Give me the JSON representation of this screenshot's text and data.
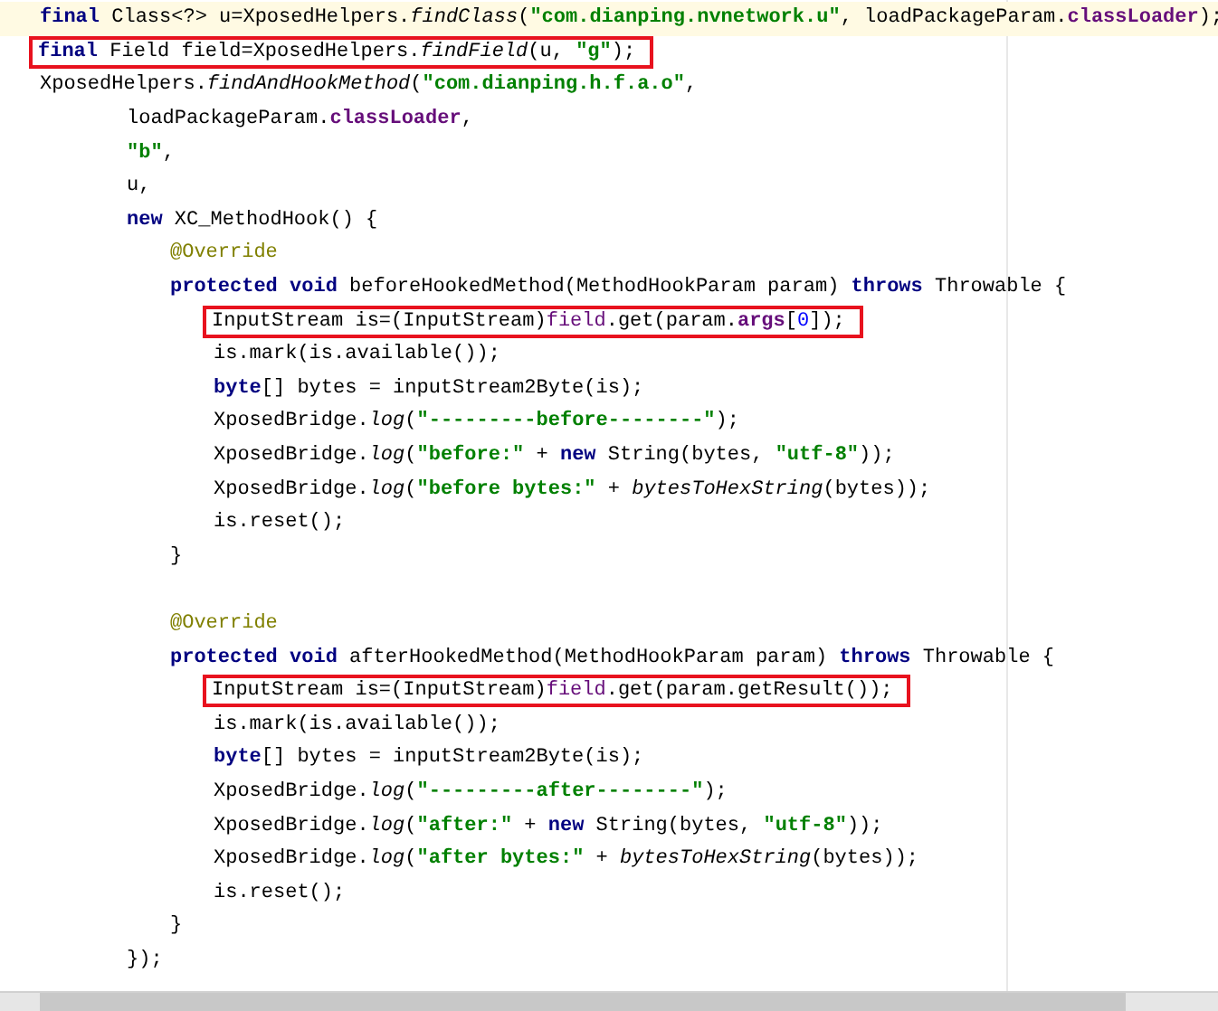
{
  "lines": [
    {
      "current": true,
      "highlighted": false,
      "tokens": [
        {
          "kind": "kw",
          "t": "final"
        },
        {
          "kind": "p",
          "t": " Class<?> u=XposedHelpers."
        },
        {
          "kind": "m",
          "t": "findClass"
        },
        {
          "kind": "p",
          "t": "("
        },
        {
          "kind": "s",
          "t": "\"com.dianping.nvnetwork.u\""
        },
        {
          "kind": "p",
          "t": ", loadPackageParam."
        },
        {
          "kind": "f",
          "t": "classLoader"
        },
        {
          "kind": "p",
          "t": ");"
        }
      ]
    },
    {
      "current": false,
      "highlighted": true,
      "tokens": [
        {
          "kind": "kw",
          "t": "final"
        },
        {
          "kind": "p",
          "t": " Field field=XposedHelpers."
        },
        {
          "kind": "m",
          "t": "findField"
        },
        {
          "kind": "p",
          "t": "(u, "
        },
        {
          "kind": "s",
          "t": "\"g\""
        },
        {
          "kind": "p",
          "t": ");"
        }
      ]
    },
    {
      "current": false,
      "highlighted": false,
      "tokens": [
        {
          "kind": "p",
          "t": "XposedHelpers."
        },
        {
          "kind": "m",
          "t": "findAndHookMethod"
        },
        {
          "kind": "p",
          "t": "("
        },
        {
          "kind": "s",
          "t": "\"com.dianping.h.f.a.o\""
        },
        {
          "kind": "p",
          "t": ","
        }
      ],
      "children": [
        {
          "current": false,
          "highlighted": false,
          "tokens": [
            {
              "kind": "p",
              "t": "loadPackageParam."
            },
            {
              "kind": "f",
              "t": "classLoader"
            },
            {
              "kind": "p",
              "t": ","
            }
          ]
        },
        {
          "current": false,
          "highlighted": false,
          "tokens": [
            {
              "kind": "s",
              "t": "\"b\""
            },
            {
              "kind": "p",
              "t": ","
            }
          ]
        },
        {
          "current": false,
          "highlighted": false,
          "tokens": [
            {
              "kind": "p",
              "t": "u,"
            }
          ]
        },
        {
          "current": false,
          "highlighted": false,
          "tokens": [
            {
              "kind": "kw",
              "t": "new"
            },
            {
              "kind": "p",
              "t": " XC_MethodHook() {"
            }
          ],
          "children": [
            {
              "current": false,
              "highlighted": false,
              "tokens": [
                {
                  "kind": "a",
                  "t": "@Override"
                }
              ]
            },
            {
              "current": false,
              "highlighted": false,
              "tokens": [
                {
                  "kind": "kw",
                  "t": "protected void"
                },
                {
                  "kind": "p",
                  "t": " beforeHookedMethod(MethodHookParam param) "
                },
                {
                  "kind": "kw",
                  "t": "throws"
                },
                {
                  "kind": "p",
                  "t": " Throwable {"
                }
              ],
              "children": [
                {
                  "current": false,
                  "highlighted": true,
                  "tokens": [
                    {
                      "kind": "p",
                      "t": "InputStream is=(InputStream)"
                    },
                    {
                      "kind": "v",
                      "t": "field"
                    },
                    {
                      "kind": "p",
                      "t": ".get(param."
                    },
                    {
                      "kind": "f",
                      "t": "args"
                    },
                    {
                      "kind": "p",
                      "t": "["
                    },
                    {
                      "kind": "n",
                      "t": "0"
                    },
                    {
                      "kind": "p",
                      "t": "]);"
                    }
                  ]
                },
                {
                  "current": false,
                  "highlighted": false,
                  "tokens": [
                    {
                      "kind": "p",
                      "t": "is.mark(is.available());"
                    }
                  ]
                },
                {
                  "current": false,
                  "highlighted": false,
                  "tokens": [
                    {
                      "kind": "kw",
                      "t": "byte"
                    },
                    {
                      "kind": "p",
                      "t": "[] bytes = inputStream2Byte(is);"
                    }
                  ]
                },
                {
                  "current": false,
                  "highlighted": false,
                  "tokens": [
                    {
                      "kind": "p",
                      "t": "XposedBridge."
                    },
                    {
                      "kind": "m",
                      "t": "log"
                    },
                    {
                      "kind": "p",
                      "t": "("
                    },
                    {
                      "kind": "s",
                      "t": "\"---------before--------\""
                    },
                    {
                      "kind": "p",
                      "t": ");"
                    }
                  ]
                },
                {
                  "current": false,
                  "highlighted": false,
                  "tokens": [
                    {
                      "kind": "p",
                      "t": "XposedBridge."
                    },
                    {
                      "kind": "m",
                      "t": "log"
                    },
                    {
                      "kind": "p",
                      "t": "("
                    },
                    {
                      "kind": "s",
                      "t": "\"before:\""
                    },
                    {
                      "kind": "p",
                      "t": " + "
                    },
                    {
                      "kind": "kw",
                      "t": "new"
                    },
                    {
                      "kind": "p",
                      "t": " String(bytes, "
                    },
                    {
                      "kind": "s",
                      "t": "\"utf-8\""
                    },
                    {
                      "kind": "p",
                      "t": "));"
                    }
                  ]
                },
                {
                  "current": false,
                  "highlighted": false,
                  "tokens": [
                    {
                      "kind": "p",
                      "t": "XposedBridge."
                    },
                    {
                      "kind": "m",
                      "t": "log"
                    },
                    {
                      "kind": "p",
                      "t": "("
                    },
                    {
                      "kind": "s",
                      "t": "\"before bytes:\""
                    },
                    {
                      "kind": "p",
                      "t": " + "
                    },
                    {
                      "kind": "m",
                      "t": "bytesToHexString"
                    },
                    {
                      "kind": "p",
                      "t": "(bytes));"
                    }
                  ]
                },
                {
                  "current": false,
                  "highlighted": false,
                  "tokens": [
                    {
                      "kind": "p",
                      "t": "is.reset();"
                    }
                  ]
                }
              ]
            },
            {
              "current": false,
              "highlighted": false,
              "tokens": [
                {
                  "kind": "p",
                  "t": "}"
                }
              ]
            },
            {
              "current": false
            },
            {
              "current": false,
              "highlighted": false,
              "tokens": [
                {
                  "kind": "a",
                  "t": "@Override"
                }
              ]
            },
            {
              "current": false,
              "highlighted": false,
              "tokens": [
                {
                  "kind": "kw",
                  "t": "protected void"
                },
                {
                  "kind": "p",
                  "t": " afterHookedMethod(MethodHookParam param) "
                },
                {
                  "kind": "kw",
                  "t": "throws"
                },
                {
                  "kind": "p",
                  "t": " Throwable {"
                }
              ],
              "children": [
                {
                  "current": false,
                  "highlighted": true,
                  "tokens": [
                    {
                      "kind": "p",
                      "t": "InputStream is=(InputStream)"
                    },
                    {
                      "kind": "v",
                      "t": "field"
                    },
                    {
                      "kind": "p",
                      "t": ".get(param.getResult());"
                    }
                  ]
                },
                {
                  "current": false,
                  "highlighted": false,
                  "tokens": [
                    {
                      "kind": "p",
                      "t": "is.mark(is.available());"
                    }
                  ]
                },
                {
                  "current": false,
                  "highlighted": false,
                  "tokens": [
                    {
                      "kind": "kw",
                      "t": "byte"
                    },
                    {
                      "kind": "p",
                      "t": "[] bytes = inputStream2Byte(is);"
                    }
                  ]
                },
                {
                  "current": false,
                  "highlighted": false,
                  "tokens": [
                    {
                      "kind": "p",
                      "t": "XposedBridge."
                    },
                    {
                      "kind": "m",
                      "t": "log"
                    },
                    {
                      "kind": "p",
                      "t": "("
                    },
                    {
                      "kind": "s",
                      "t": "\"---------after--------\""
                    },
                    {
                      "kind": "p",
                      "t": ");"
                    }
                  ]
                },
                {
                  "current": false,
                  "highlighted": false,
                  "tokens": [
                    {
                      "kind": "p",
                      "t": "XposedBridge."
                    },
                    {
                      "kind": "m",
                      "t": "log"
                    },
                    {
                      "kind": "p",
                      "t": "("
                    },
                    {
                      "kind": "s",
                      "t": "\"after:\""
                    },
                    {
                      "kind": "p",
                      "t": " + "
                    },
                    {
                      "kind": "kw",
                      "t": "new"
                    },
                    {
                      "kind": "p",
                      "t": " String(bytes, "
                    },
                    {
                      "kind": "s",
                      "t": "\"utf-8\""
                    },
                    {
                      "kind": "p",
                      "t": "));"
                    }
                  ]
                },
                {
                  "current": false,
                  "highlighted": false,
                  "tokens": [
                    {
                      "kind": "p",
                      "t": "XposedBridge."
                    },
                    {
                      "kind": "m",
                      "t": "log"
                    },
                    {
                      "kind": "p",
                      "t": "("
                    },
                    {
                      "kind": "s",
                      "t": "\"after bytes:\""
                    },
                    {
                      "kind": "p",
                      "t": " + "
                    },
                    {
                      "kind": "m",
                      "t": "bytesToHexString"
                    },
                    {
                      "kind": "p",
                      "t": "(bytes));"
                    }
                  ]
                },
                {
                  "current": false,
                  "highlighted": false,
                  "tokens": [
                    {
                      "kind": "p",
                      "t": "is.reset();"
                    }
                  ]
                }
              ]
            },
            {
              "current": false,
              "highlighted": false,
              "tokens": [
                {
                  "kind": "p",
                  "t": "}"
                }
              ]
            }
          ]
        },
        {
          "current": false,
          "highlighted": false,
          "tokens": [
            {
              "kind": "p",
              "t": "});"
            }
          ]
        }
      ]
    }
  ]
}
